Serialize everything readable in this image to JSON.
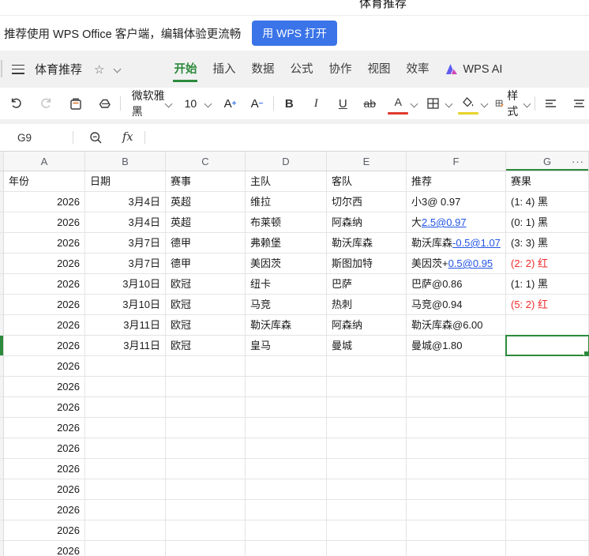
{
  "page": {
    "doc_title": "体育推荐"
  },
  "banner": {
    "message": "推荐使用 WPS Office 客户端，编辑体验更流畅",
    "open_button": "用 WPS 打开"
  },
  "menubar": {
    "doc_name": "体育推荐",
    "tabs": [
      {
        "label": "开始",
        "active": true
      },
      {
        "label": "插入",
        "active": false
      },
      {
        "label": "数据",
        "active": false
      },
      {
        "label": "公式",
        "active": false
      },
      {
        "label": "协作",
        "active": false
      },
      {
        "label": "视图",
        "active": false
      },
      {
        "label": "效率",
        "active": false
      }
    ],
    "wps_ai_label": "WPS AI"
  },
  "toolbar": {
    "font_name": "微软雅黑",
    "font_size": "10",
    "bold": "B",
    "italic": "I",
    "underline": "U",
    "strike": "ab",
    "font_color_letter": "A",
    "style_label": "样式"
  },
  "formula_bar": {
    "cell_ref": "G9",
    "fx_label": "fx"
  },
  "sheet": {
    "col_headers": [
      "A",
      "B",
      "C",
      "D",
      "E",
      "F",
      "G"
    ],
    "active_col": "G",
    "more_cols": "···",
    "header_row": {
      "year": "年份",
      "date": "日期",
      "league": "赛事",
      "home": "主队",
      "away": "客队",
      "tip": "推荐",
      "result": "赛果"
    },
    "selection": {
      "cell_ref": "G9"
    },
    "rows": [
      {
        "year": "2026",
        "date": "3月4日",
        "league": "英超",
        "home": "维拉",
        "away": "切尔西",
        "tip_plain": "小3@ 0.97",
        "tip_link": "",
        "result": "(1: 4) 黑",
        "result_red": false,
        "selected": false
      },
      {
        "year": "2026",
        "date": "3月4日",
        "league": "英超",
        "home": "布莱顿",
        "away": "阿森纳",
        "tip_plain": "大",
        "tip_link": "2.5@0.97",
        "result": "(0: 1) 黑",
        "result_red": false,
        "selected": false
      },
      {
        "year": "2026",
        "date": "3月7日",
        "league": "德甲",
        "home": "弗赖堡",
        "away": "勒沃库森",
        "tip_plain": "勒沃库森",
        "tip_link": "-0.5@1.07",
        "result": "(3: 3) 黑",
        "result_red": false,
        "selected": false
      },
      {
        "year": "2026",
        "date": "3月7日",
        "league": "德甲",
        "home": "美因茨",
        "away": "斯图加特",
        "tip_plain": "美因茨+",
        "tip_link": "0.5@0.95",
        "result": "(2: 2) 红",
        "result_red": true,
        "selected": false
      },
      {
        "year": "2026",
        "date": "3月10日",
        "league": "欧冠",
        "home": "纽卡",
        "away": "巴萨",
        "tip_plain": "巴萨@0.86",
        "tip_link": "",
        "result": "(1: 1) 黑",
        "result_red": false,
        "selected": false
      },
      {
        "year": "2026",
        "date": "3月10日",
        "league": "欧冠",
        "home": "马竞",
        "away": "热刺",
        "tip_plain": "马竞@0.94",
        "tip_link": "",
        "result": "(5: 2) 红",
        "result_red": true,
        "selected": false
      },
      {
        "year": "2026",
        "date": "3月11日",
        "league": "欧冠",
        "home": "勒沃库森",
        "away": "阿森纳",
        "tip_plain": "勒沃库森@6.00",
        "tip_link": "",
        "result": "",
        "result_red": false,
        "selected": false
      },
      {
        "year": "2026",
        "date": "3月11日",
        "league": "欧冠",
        "home": "皇马",
        "away": "曼城",
        "tip_plain": "曼城@1.80",
        "tip_link": "",
        "result": "",
        "result_red": false,
        "selected": true
      },
      {
        "year": "2026",
        "date": "",
        "league": "",
        "home": "",
        "away": "",
        "tip_plain": "",
        "tip_link": "",
        "result": "",
        "result_red": false,
        "selected": false
      },
      {
        "year": "2026",
        "date": "",
        "league": "",
        "home": "",
        "away": "",
        "tip_plain": "",
        "tip_link": "",
        "result": "",
        "result_red": false,
        "selected": false
      },
      {
        "year": "2026",
        "date": "",
        "league": "",
        "home": "",
        "away": "",
        "tip_plain": "",
        "tip_link": "",
        "result": "",
        "result_red": false,
        "selected": false
      },
      {
        "year": "2026",
        "date": "",
        "league": "",
        "home": "",
        "away": "",
        "tip_plain": "",
        "tip_link": "",
        "result": "",
        "result_red": false,
        "selected": false
      },
      {
        "year": "2026",
        "date": "",
        "league": "",
        "home": "",
        "away": "",
        "tip_plain": "",
        "tip_link": "",
        "result": "",
        "result_red": false,
        "selected": false
      },
      {
        "year": "2026",
        "date": "",
        "league": "",
        "home": "",
        "away": "",
        "tip_plain": "",
        "tip_link": "",
        "result": "",
        "result_red": false,
        "selected": false
      },
      {
        "year": "2026",
        "date": "",
        "league": "",
        "home": "",
        "away": "",
        "tip_plain": "",
        "tip_link": "",
        "result": "",
        "result_red": false,
        "selected": false
      },
      {
        "year": "2026",
        "date": "",
        "league": "",
        "home": "",
        "away": "",
        "tip_plain": "",
        "tip_link": "",
        "result": "",
        "result_red": false,
        "selected": false
      },
      {
        "year": "2026",
        "date": "",
        "league": "",
        "home": "",
        "away": "",
        "tip_plain": "",
        "tip_link": "",
        "result": "",
        "result_red": false,
        "selected": false
      },
      {
        "year": "2026",
        "date": "",
        "league": "",
        "home": "",
        "away": "",
        "tip_plain": "",
        "tip_link": "",
        "result": "",
        "result_red": false,
        "selected": false
      }
    ]
  },
  "colors": {
    "accent_green": "#2d8a3c",
    "button_blue": "#3b74e8",
    "link_blue": "#2254e3",
    "result_red": "#ee2b2b"
  }
}
